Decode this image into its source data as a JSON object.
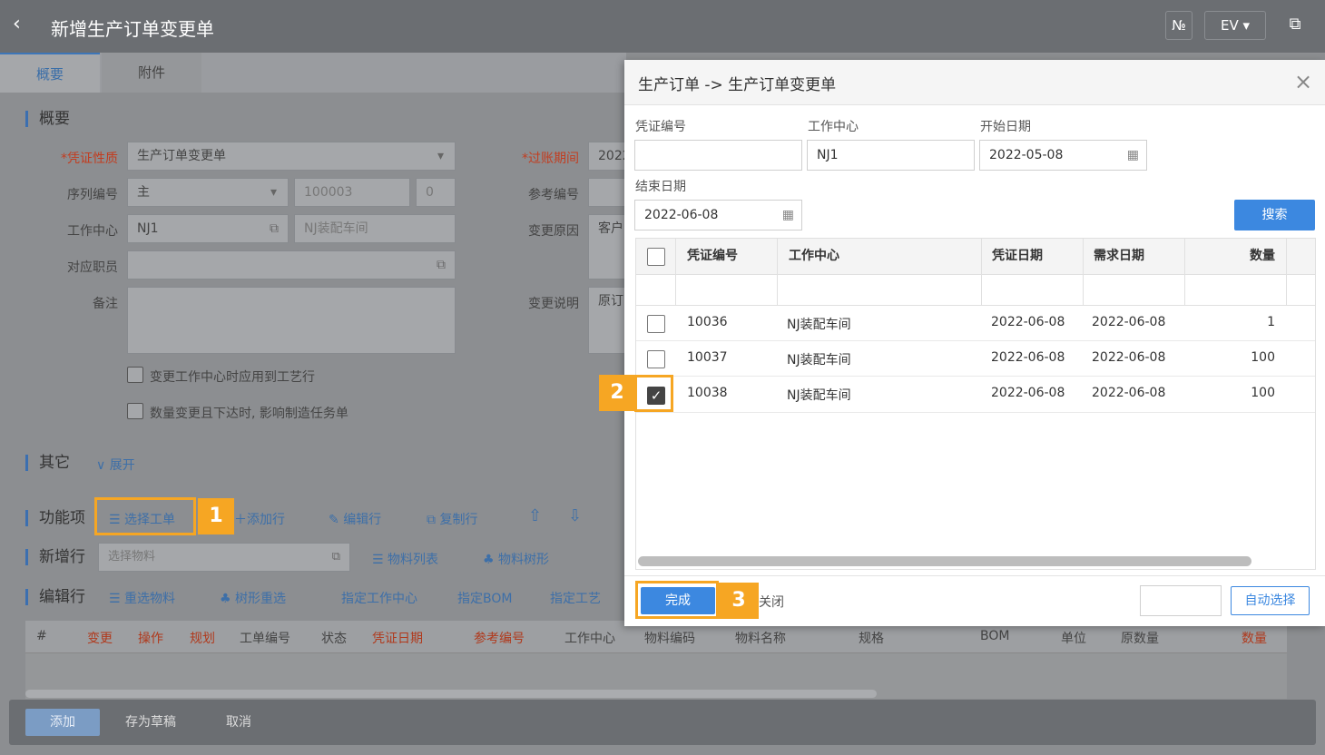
{
  "header": {
    "back_icon": "‹",
    "title": "新增生产订单变更单",
    "btn_no": "№",
    "btn_ev": "EV ▾",
    "external_icon": "⧉"
  },
  "tabs": [
    {
      "label": "概要"
    },
    {
      "label": "附件"
    }
  ],
  "summary": {
    "section": "概要",
    "voucher_type_label": "*凭证性质",
    "voucher_type": "生产订单变更单",
    "posting_label": "*过账期间",
    "posting_value": "2022",
    "serial_label": "序列编号",
    "serial_value": "主",
    "serial_no": "100003",
    "serial_num": "0",
    "ref_label": "参考编号",
    "wc_label": "工作中心",
    "wc_value": "NJ1",
    "wc_name": "NJ装配车间",
    "reason_label": "变更原因",
    "reason_value": "客户",
    "staff_label": "对应职员",
    "note_label": "备注",
    "desc_label": "变更说明",
    "desc_value": "原订",
    "check1": "变更工作中心时应用到工艺行",
    "check2": "数量变更且下达时, 影响制造任务单"
  },
  "other": {
    "section": "其它",
    "expand": "∨ 展开"
  },
  "func": {
    "section": "功能项",
    "select_order": "选择工单",
    "add_row": "添加行",
    "edit_row": "编辑行",
    "copy_row": "复制行"
  },
  "newrow": {
    "section": "新增行",
    "placeholder": "选择物料",
    "mat_list": "物料列表",
    "mat_tree": "物料树形"
  },
  "editrow": {
    "section": "编辑行",
    "reselect": "重选物料",
    "tree_reselect": "树形重选",
    "assign_wc": "指定工作中心",
    "assign_bom": "指定BOM",
    "assign_route": "指定工艺"
  },
  "grid_headers": [
    "#",
    "变更",
    "操作",
    "规划",
    "工单编号",
    "状态",
    "凭证日期",
    "参考编号",
    "工作中心",
    "物料编码",
    "物料名称",
    "规格",
    "BOM",
    "单位",
    "原数量",
    "数量"
  ],
  "footer": {
    "add": "添加",
    "draft": "存为草稿",
    "cancel": "取消"
  },
  "dialog": {
    "title": "生产订单 -> 生产订单变更单",
    "close_icon": "×",
    "voucher_no_label": "凭证编号",
    "voucher_no_value": "",
    "wc_label": "工作中心",
    "wc_value": "NJ1",
    "start_label": "开始日期",
    "start_value": "2022-05-08",
    "end_label": "结束日期",
    "end_value": "2022-06-08",
    "search": "搜索",
    "columns": [
      "凭证编号",
      "工作中心",
      "凭证日期",
      "需求日期",
      "数量"
    ],
    "rows": [
      {
        "no": "10036",
        "wc": "NJ装配车间",
        "vdate": "2022-06-08",
        "rdate": "2022-06-08",
        "qty": "1",
        "checked": false
      },
      {
        "no": "10037",
        "wc": "NJ装配车间",
        "vdate": "2022-06-08",
        "rdate": "2022-06-08",
        "qty": "100",
        "checked": false
      },
      {
        "no": "10038",
        "wc": "NJ装配车间",
        "vdate": "2022-06-08",
        "rdate": "2022-06-08",
        "qty": "100",
        "checked": true
      }
    ],
    "done": "完成",
    "close": "关闭",
    "auto_select": "自动选择"
  },
  "badges": [
    "1",
    "2",
    "3"
  ],
  "colors": {
    "accent": "#3c88e0",
    "highlight": "#f6a623",
    "overlay": "#8c8e91"
  }
}
